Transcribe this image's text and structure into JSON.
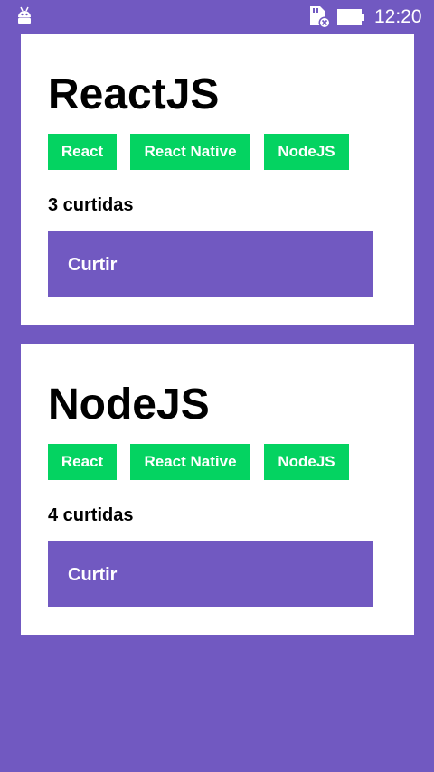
{
  "status_bar": {
    "time": "12:20",
    "left_icon": "android-icon",
    "sd_icon": "sd-card-error-icon",
    "battery_icon": "battery-icon"
  },
  "repositories": [
    {
      "title": "ReactJS",
      "techs": [
        "React",
        "React Native",
        "NodeJS"
      ],
      "likes_text": "3 curtidas",
      "button_label": "Curtir"
    },
    {
      "title": "NodeJS",
      "techs": [
        "React",
        "React Native",
        "NodeJS"
      ],
      "likes_text": "4 curtidas",
      "button_label": "Curtir"
    }
  ],
  "colors": {
    "background": "#7159c1",
    "card": "#ffffff",
    "tag": "#04d361",
    "button": "#7159c1"
  }
}
